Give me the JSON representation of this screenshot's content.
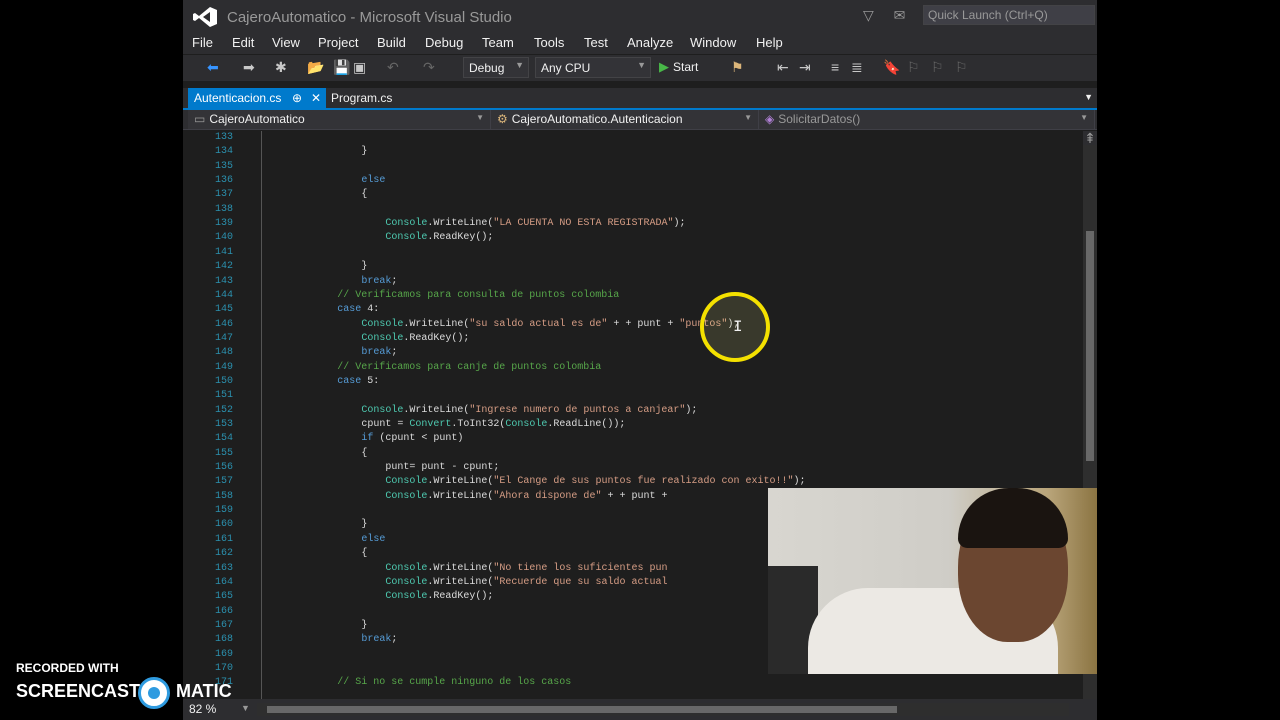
{
  "window": {
    "title": "CajeroAutomatico - Microsoft Visual Studio",
    "quick_launch_placeholder": "Quick Launch (Ctrl+Q)"
  },
  "menu": [
    "File",
    "Edit",
    "View",
    "Project",
    "Build",
    "Debug",
    "Team",
    "Tools",
    "Test",
    "Analyze",
    "Window",
    "Help"
  ],
  "toolbar": {
    "configuration": "Debug",
    "platform": "Any CPU",
    "start_label": "Start"
  },
  "tabs": [
    {
      "label": "Autenticacion.cs",
      "pin": "⊕",
      "close": "✕",
      "active": true
    },
    {
      "label": "Program.cs",
      "active": false
    }
  ],
  "navbar": {
    "project": "CajeroAutomatico",
    "class": "CajeroAutomatico.Autenticacion",
    "member": "SolicitarDatos()"
  },
  "code_lines": [
    {
      "n": "133",
      "indent": 0,
      "t": ""
    },
    {
      "n": "134",
      "indent": 16,
      "t": "}"
    },
    {
      "n": "135",
      "indent": 0,
      "t": ""
    },
    {
      "n": "136",
      "indent": 16,
      "t": "else"
    },
    {
      "n": "137",
      "indent": 16,
      "t": "{"
    },
    {
      "n": "138",
      "indent": 0,
      "t": ""
    },
    {
      "n": "139",
      "indent": 20,
      "t": "Console.WriteLine(\"LA CUENTA NO ESTA REGISTRADA\");"
    },
    {
      "n": "140",
      "indent": 20,
      "t": "Console.ReadKey();"
    },
    {
      "n": "141",
      "indent": 0,
      "t": ""
    },
    {
      "n": "142",
      "indent": 16,
      "t": "}"
    },
    {
      "n": "143",
      "indent": 16,
      "t": "break;"
    },
    {
      "n": "144",
      "indent": 12,
      "t": "// Verificamos para consulta de puntos colombia"
    },
    {
      "n": "145",
      "indent": 12,
      "t": "case 4:"
    },
    {
      "n": "146",
      "indent": 16,
      "t": "Console.WriteLine(\"su saldo actual es de\" + + punt + \"puntos\");"
    },
    {
      "n": "147",
      "indent": 16,
      "t": "Console.ReadKey();"
    },
    {
      "n": "148",
      "indent": 16,
      "t": "break;"
    },
    {
      "n": "149",
      "indent": 12,
      "t": "// Verificamos para canje de puntos colombia"
    },
    {
      "n": "150",
      "indent": 12,
      "t": "case 5:"
    },
    {
      "n": "151",
      "indent": 0,
      "t": ""
    },
    {
      "n": "152",
      "indent": 16,
      "t": "Console.WriteLine(\"Ingrese numero de puntos a canjear\");"
    },
    {
      "n": "153",
      "indent": 16,
      "t": "cpunt = Convert.ToInt32(Console.ReadLine());"
    },
    {
      "n": "154",
      "indent": 16,
      "t": "if (cpunt < punt)"
    },
    {
      "n": "155",
      "indent": 16,
      "t": "{"
    },
    {
      "n": "156",
      "indent": 20,
      "t": "punt= punt - cpunt;"
    },
    {
      "n": "157",
      "indent": 20,
      "t": "Console.WriteLine(\"El Cange de sus puntos fue realizado con exito!!\");"
    },
    {
      "n": "158",
      "indent": 20,
      "t": "Console.WriteLine(\"Ahora dispone de\" + + punt +"
    },
    {
      "n": "159",
      "indent": 0,
      "t": ""
    },
    {
      "n": "160",
      "indent": 16,
      "t": "}"
    },
    {
      "n": "161",
      "indent": 16,
      "t": "else"
    },
    {
      "n": "162",
      "indent": 16,
      "t": "{"
    },
    {
      "n": "163",
      "indent": 20,
      "t": "Console.WriteLine(\"No tiene los suficientes pun"
    },
    {
      "n": "164",
      "indent": 20,
      "t": "Console.WriteLine(\"Recuerde que su saldo actual"
    },
    {
      "n": "165",
      "indent": 20,
      "t": "Console.ReadKey();"
    },
    {
      "n": "166",
      "indent": 0,
      "t": ""
    },
    {
      "n": "167",
      "indent": 16,
      "t": "}"
    },
    {
      "n": "168",
      "indent": 16,
      "t": "break;"
    },
    {
      "n": "169",
      "indent": 0,
      "t": ""
    },
    {
      "n": "170",
      "indent": 0,
      "t": ""
    },
    {
      "n": "171",
      "indent": 12,
      "t": "// Si no se cumple ninguno de los casos"
    }
  ],
  "status": {
    "zoom": "82 %"
  },
  "watermark": {
    "top": "RECORDED WITH",
    "left": "SCREENCAST",
    "right": "MATIC"
  },
  "colors": {
    "accent": "#007acc",
    "keyword": "#569cd6",
    "comment": "#57a64a",
    "string": "#d69d85",
    "type": "#4ec9b0",
    "line_number": "#2b91af",
    "cursor_ring": "#f4e100"
  }
}
